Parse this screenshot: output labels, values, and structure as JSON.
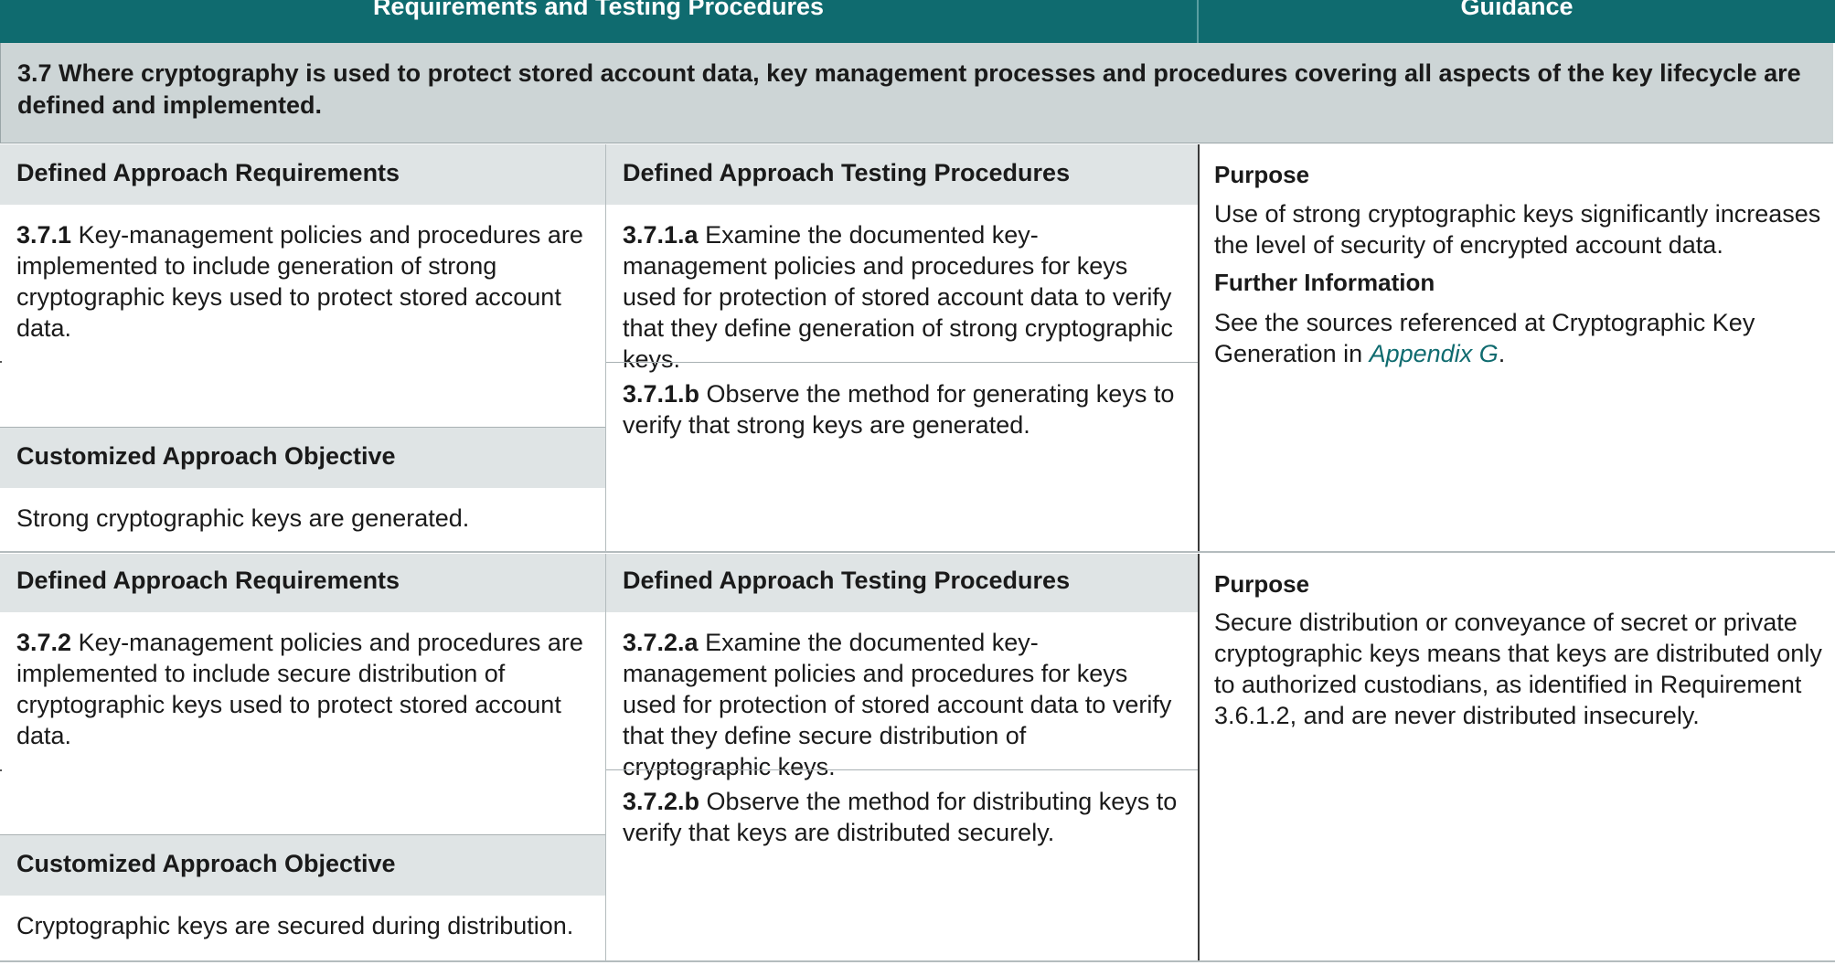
{
  "header": {
    "left": "Requirements and Testing Procedures",
    "right": "Guidance"
  },
  "section": {
    "title": "3.7 Where cryptography is used to protect stored account data, key management processes and procedures covering all aspects of the key lifecycle are defined and implemented."
  },
  "blocks": [
    {
      "req_heading": "Defined Approach Requirements",
      "req_num": "3.7.1",
      "req_text": " Key-management policies and procedures are implemented to include generation of strong cryptographic keys used to protect stored account data.",
      "cust_heading": "Customized Approach Objective",
      "cust_text": "Strong cryptographic keys are generated.",
      "test_heading": "Defined Approach Testing Procedures",
      "test_a_num": "3.7.1.a",
      "test_a_text": " Examine the documented key-management policies and procedures for keys used for protection of stored account data to verify that they define generation of strong cryptographic keys.",
      "test_b_num": "3.7.1.b",
      "test_b_text": " Observe the method for generating keys to verify that strong keys are generated.",
      "purpose_heading": "Purpose",
      "purpose_text": "Use of strong cryptographic keys significantly increases the level of security of encrypted account data.",
      "further_heading": "Further Information",
      "further_text_before": "See the sources referenced at Cryptographic Key Generation in ",
      "further_link": "Appendix G",
      "further_text_after": "."
    },
    {
      "req_heading": "Defined Approach Requirements",
      "req_num": "3.7.2",
      "req_text": " Key-management policies and procedures are implemented to include secure distribution of cryptographic keys used to protect stored account data.",
      "cust_heading": "Customized Approach Objective",
      "cust_text": "Cryptographic keys are secured during distribution.",
      "test_heading": "Defined Approach Testing Procedures",
      "test_a_num": "3.7.2.a",
      "test_a_text": " Examine the documented key-management policies and procedures for keys used for protection of stored account data to verify that they define secure distribution of cryptographic keys.",
      "test_b_num": "3.7.2.b",
      "test_b_text": " Observe the method for distributing keys to verify that keys are distributed securely.",
      "purpose_heading": "Purpose",
      "purpose_text": "Secure distribution or conveyance of secret or private cryptographic keys means that keys are distributed only to authorized custodians, as identified in Requirement 3.6.1.2, and are never distributed insecurely."
    }
  ],
  "colors": {
    "header_bg": "#0f6b6f",
    "section_bg": "#cdd5d6",
    "subheader_bg": "#dfe4e5",
    "link": "#0f6b6f"
  }
}
